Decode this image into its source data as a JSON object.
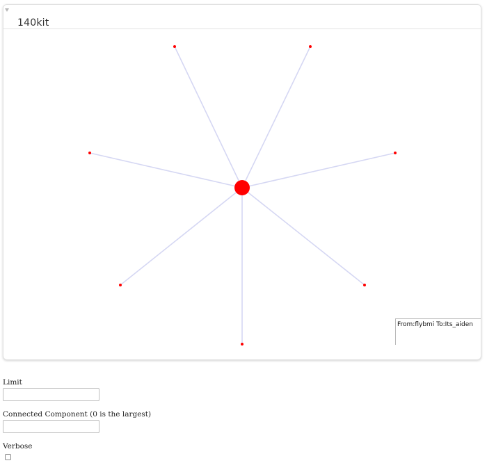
{
  "panel": {
    "title": "140kit"
  },
  "graph": {
    "hub": {
      "color": "#ff0000"
    },
    "leaves": [
      {
        "color": "#ff0000"
      },
      {
        "color": "#ff0000"
      },
      {
        "color": "#ff0000"
      },
      {
        "color": "#ff0000"
      },
      {
        "color": "#ff0000"
      },
      {
        "color": "#ff0000"
      },
      {
        "color": "#ff0000"
      }
    ],
    "edge_color": "#d5d7f3"
  },
  "tooltip": {
    "text": "From:flybmi To:Its_aiden"
  },
  "form": {
    "limit_label": "Limit",
    "limit_value": "",
    "component_label": "Connected Component (0 is the largest)",
    "component_value": "",
    "verbose_label": "Verbose",
    "verbose_checked": false
  }
}
